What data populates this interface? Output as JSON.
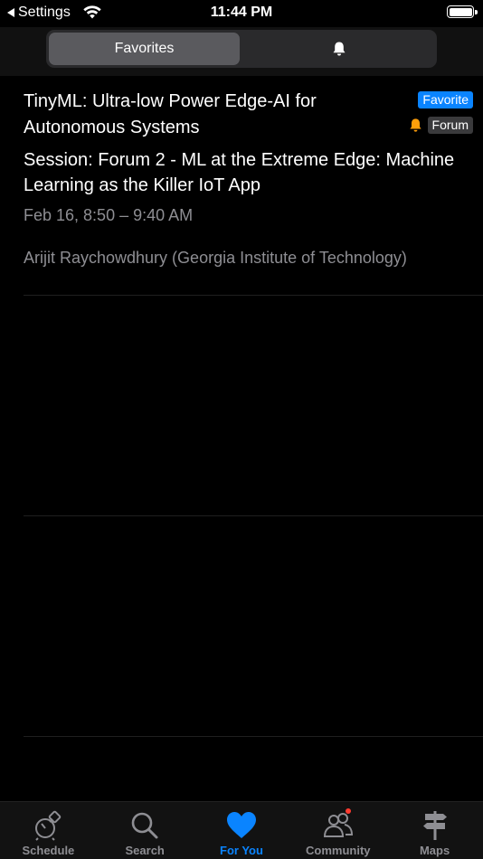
{
  "status_bar": {
    "back_label": "Settings",
    "time": "11:44 PM"
  },
  "segmented": {
    "favorites_label": "Favorites",
    "selected": "Favorites"
  },
  "event": {
    "title": "TinyML: Ultra-low Power Edge-AI for Autonomous Systems",
    "badge_favorite": "Favorite",
    "badge_forum": "Forum",
    "session": "Session: Forum 2 - ML at the Extreme Edge: Machine Learning as the Killer IoT App",
    "time": "Feb 16, 8:50 – 9:40 AM",
    "speaker": "Arijit Raychowdhury (Georgia Institute of Technology)"
  },
  "tab_bar": {
    "items": [
      {
        "label": "Schedule",
        "icon": "schedule-icon"
      },
      {
        "label": "Search",
        "icon": "search-icon"
      },
      {
        "label": "For You",
        "icon": "heart-icon"
      },
      {
        "label": "Community",
        "icon": "community-icon"
      },
      {
        "label": "Maps",
        "icon": "signpost-icon"
      }
    ],
    "active": "For You"
  },
  "colors": {
    "accent": "#0a84ff",
    "notification_bell": "#ff9f0a",
    "badge_dot": "#ff3b30",
    "secondary_text": "#8e8e93"
  }
}
